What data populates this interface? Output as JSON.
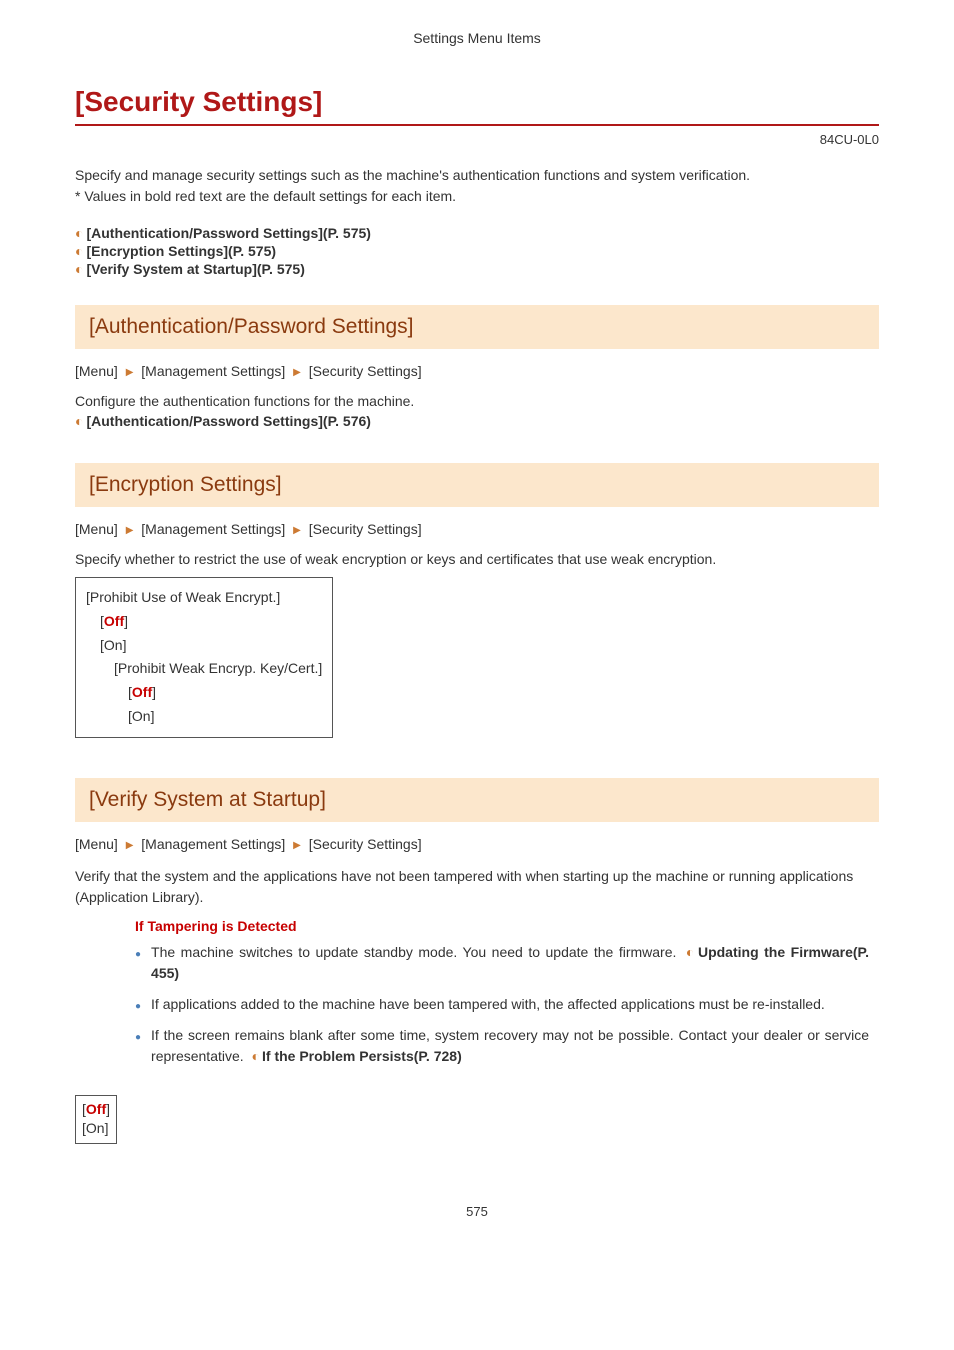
{
  "header": "Settings Menu Items",
  "title": "[Security Settings]",
  "docId": "84CU-0L0",
  "intro_line1": "Specify and manage security settings such as the machine's authentication functions and system verification.",
  "intro_line2": "* Values in bold red text are the default settings for each item.",
  "toc": {
    "i0": "[Authentication/Password Settings](P. 575)",
    "i1": "[Encryption Settings](P. 575)",
    "i2": "[Verify System at Startup](P. 575)"
  },
  "bc": {
    "menu": "[Menu]",
    "mgmt": "[Management Settings]",
    "sec": "[Security Settings]"
  },
  "sec1": {
    "heading": "[Authentication/Password Settings]",
    "desc": "Configure the authentication functions for the machine.",
    "link": "[Authentication/Password Settings](P. 576)"
  },
  "sec2": {
    "heading": "[Encryption Settings]",
    "desc": "Specify whether to restrict the use of weak encryption or keys and certificates that use weak encryption.",
    "box": {
      "l0": "[Prohibit Use of Weak Encrypt.]",
      "l1a": "[",
      "l1b": "Off",
      "l1c": "]",
      "l2": "[On]",
      "l3": "[Prohibit Weak Encryp. Key/Cert.]",
      "l4a": "[",
      "l4b": "Off",
      "l4c": "]",
      "l5": "[On]"
    }
  },
  "sec3": {
    "heading": "[Verify System at Startup]",
    "desc": "Verify that the system and the applications have not been tampered with when starting up the machine or running applications (Application Library).",
    "callout_title": "If Tampering is Detected",
    "b0_a": "The machine switches to update standby mode. You need to update the firmware. ",
    "b0_link": "Updating the Firmware(P. 455)",
    "b1": "If applications added to the machine have been tampered with, the affected applications must be re-installed.",
    "b2_a": "If the screen remains blank after some time, system recovery may not be possible. Contact your dealer or service representative. ",
    "b2_link": "If the Problem Persists(P. 728)",
    "box": {
      "l0a": "[",
      "l0b": "Off",
      "l0c": "]",
      "l1": "[On]"
    }
  },
  "pageNum": "575"
}
